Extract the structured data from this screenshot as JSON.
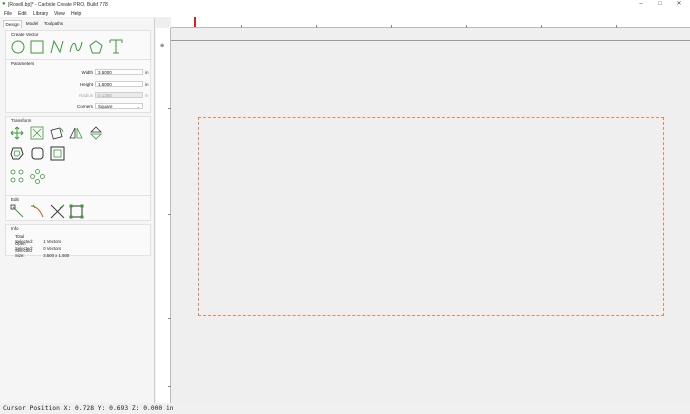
{
  "window": {
    "title": "[Rosell.bp]* - Carbide Create PRO, Build 778",
    "app_icon": "carbide-logo-icon",
    "controls": [
      "minimize-icon",
      "maximize-icon",
      "close-icon"
    ]
  },
  "menu": {
    "file": "File",
    "edit": "Edit",
    "library": "Library",
    "view": "View",
    "help": "Help"
  },
  "tabs": {
    "design": "Design",
    "model": "Model",
    "toolpaths": "Toolpaths",
    "active": "Design"
  },
  "create_vector": {
    "title": "Create Vector",
    "tools": [
      "circle-icon",
      "rectangle-icon",
      "polyline-icon",
      "curve-icon",
      "polygon-icon",
      "text-icon"
    ]
  },
  "parameters": {
    "title": "Parameters",
    "width_label": "Width",
    "width_value": "3.5000",
    "height_label": "Height",
    "height_value": "1.5000",
    "radius_label": "Radius",
    "radius_value": "0.1300",
    "corners_label": "Corners",
    "corners_value": "Square",
    "unit": "in"
  },
  "transform": {
    "title": "Transform"
  },
  "edit": {
    "title": "Edit"
  },
  "info": {
    "title": "Info",
    "total_selected_label": "Total Selected:",
    "total_selected_value": "1 Vectors",
    "open_selected_label": "Open Selected:",
    "open_selected_value": "0 Vectors",
    "selected_size_label": "Selected Size:",
    "selected_size_value": "3.500 x 1.500"
  },
  "status": {
    "cursor_position": "Cursor Position X: 0.728 Y: 0.693 Z: 0.000 in"
  },
  "colors": {
    "accent_green": "#3a9a3a",
    "workpiece_border": "#e08a55",
    "ruler_marker": "#e02020"
  }
}
